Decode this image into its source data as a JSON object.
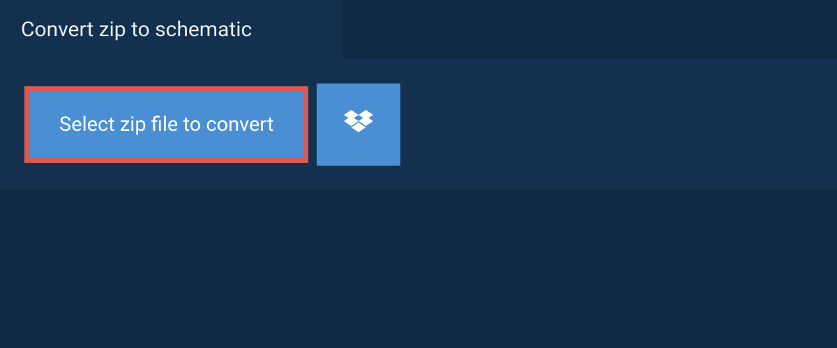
{
  "header": {
    "title": "Convert zip to schematic"
  },
  "upload": {
    "select_button_label": "Select zip file to convert",
    "dropbox_icon": "dropbox"
  },
  "colors": {
    "background": "#0f2a43",
    "panel": "#13314f",
    "button_primary": "#4a8fd4",
    "highlight_border": "#d95a52",
    "text_light": "#e8eef4"
  }
}
